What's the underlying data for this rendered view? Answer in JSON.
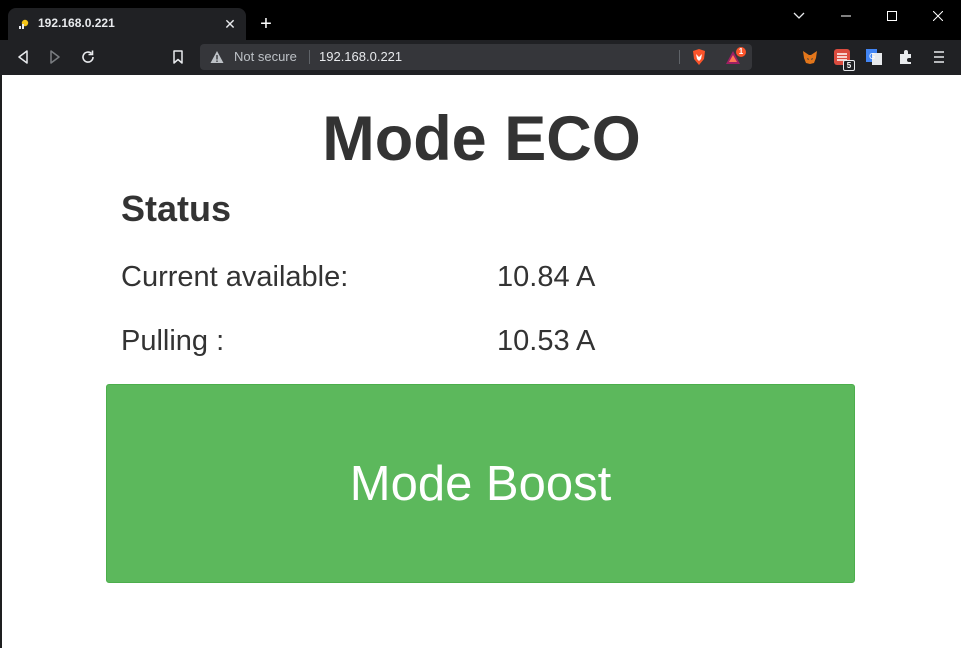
{
  "browser": {
    "tab": {
      "title": "192.168.0.221",
      "close_glyph": "✕"
    },
    "new_tab_glyph": "+",
    "omnibox": {
      "security_label": "Not secure",
      "url": "192.168.0.221"
    },
    "extensions": {
      "brave_rewards_badge": "1",
      "todoist_badge": "5"
    }
  },
  "page": {
    "title": "Mode ECO",
    "status_heading": "Status",
    "rows": [
      {
        "label": "Current available:",
        "value": "10.84 A"
      },
      {
        "label": "Pulling :",
        "value": "10.53 A"
      }
    ],
    "button_label": "Mode Boost",
    "colors": {
      "button_bg": "#5cb85c",
      "text": "#333333"
    }
  }
}
